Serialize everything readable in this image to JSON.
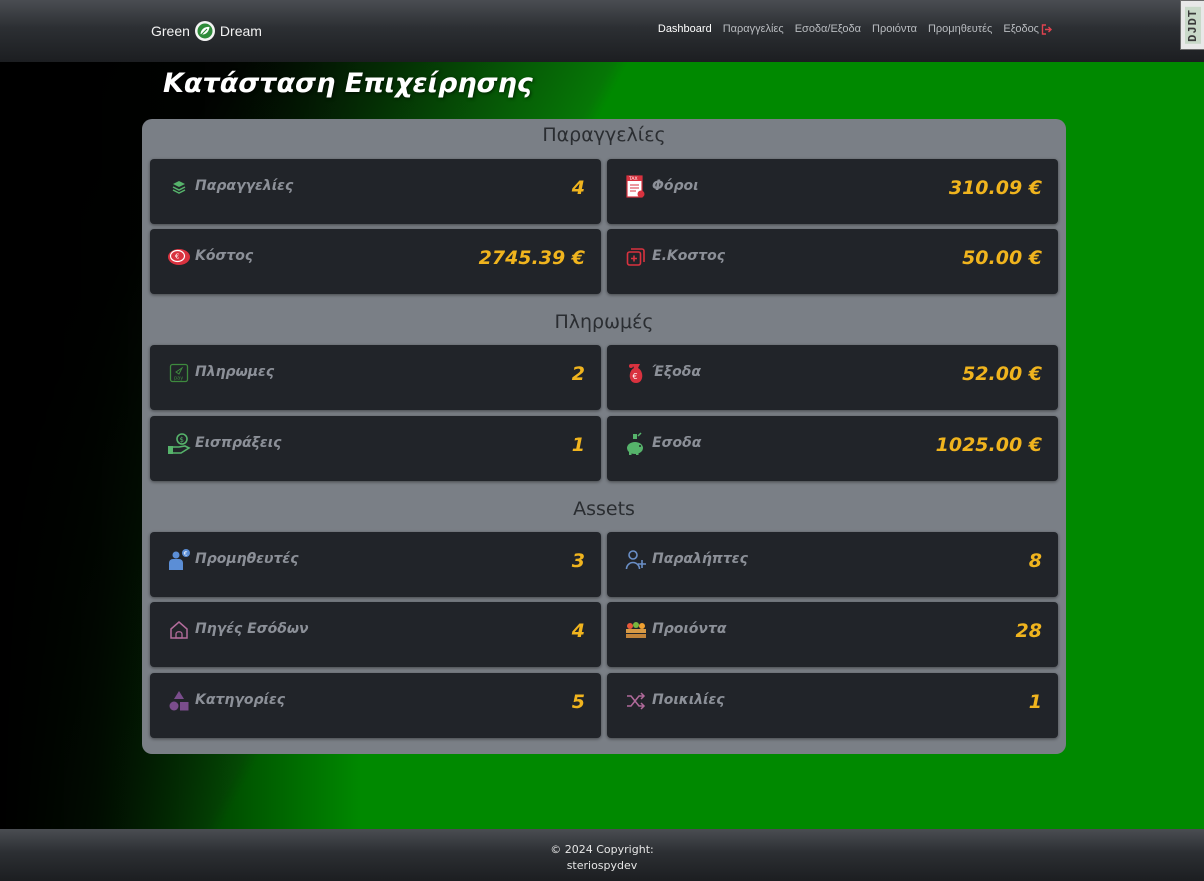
{
  "brand": {
    "left": "Green",
    "right": "Dream"
  },
  "nav": {
    "items": [
      "Dashboard",
      "Παραγγελίες",
      "Εσοδα/Εξοδα",
      "Προιόντα",
      "Προμηθευτές"
    ],
    "logout": "Εξοδος"
  },
  "djdt": "DJDT",
  "page_title": "Κατάσταση Επιχείρησης",
  "sections": [
    {
      "title": "Παραγγελίες",
      "cards": [
        {
          "label": "Παραγγελίες",
          "value": "4",
          "icon": "layers-icon"
        },
        {
          "label": "Φόροι",
          "value": "310.09 €",
          "icon": "tax-icon"
        },
        {
          "label": "Κόστος",
          "value": "2745.39 €",
          "icon": "euro-coin-icon"
        },
        {
          "label": "Ε.Κοστος",
          "value": "50.00 €",
          "icon": "copy-plus-icon"
        }
      ]
    },
    {
      "title": "Πληρωμές",
      "cards": [
        {
          "label": "Πληρωμες",
          "value": "2",
          "icon": "pay-icon"
        },
        {
          "label": "Έξοδα",
          "value": "52.00 €",
          "icon": "money-bag-icon"
        },
        {
          "label": "Εισπράξεις",
          "value": "1",
          "icon": "hand-coin-icon"
        },
        {
          "label": "Εσοδα",
          "value": "1025.00 €",
          "icon": "piggy-bank-icon"
        }
      ]
    },
    {
      "title": "Assets",
      "cards": [
        {
          "label": "Προμηθευτές",
          "value": "3",
          "icon": "supplier-icon"
        },
        {
          "label": "Παραλήπτες",
          "value": "8",
          "icon": "user-plus-icon"
        },
        {
          "label": "Πηγές Εσόδων",
          "value": "4",
          "icon": "house-icon"
        },
        {
          "label": "Προιόντα",
          "value": "28",
          "icon": "produce-crate-icon"
        },
        {
          "label": "Κατηγορίες",
          "value": "5",
          "icon": "shapes-icon"
        },
        {
          "label": "Ποικιλίες",
          "value": "1",
          "icon": "shuffle-icon"
        }
      ]
    }
  ],
  "footer": {
    "line1": "© 2024 Copyright:",
    "line2": "steriospydev"
  }
}
